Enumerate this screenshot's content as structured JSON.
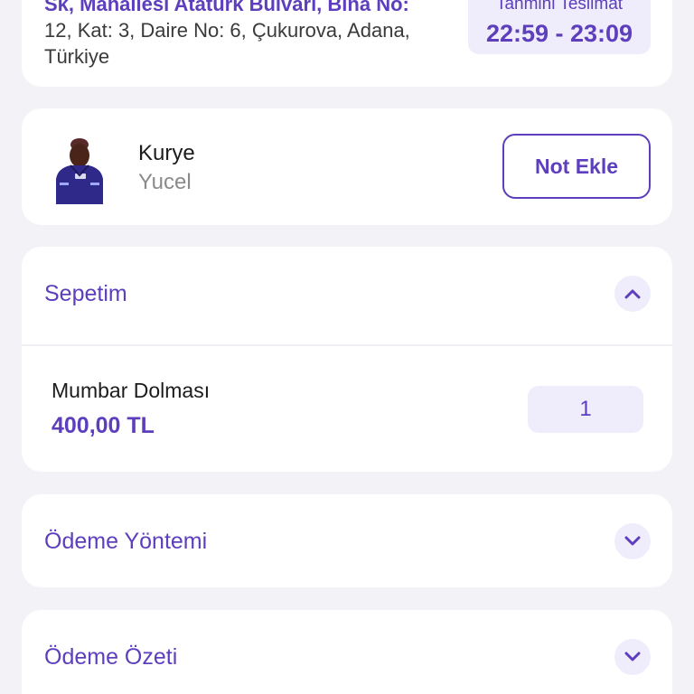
{
  "address": {
    "line_partial": "Sk, Mahallesi Atatürk Bulvarı, Bina No:",
    "line2": "12, Kat: 3, Daire No: 6, Çukurova, Adana,",
    "line3": "Türkiye"
  },
  "eta": {
    "label": "Tahmini Teslimat",
    "value": "22:59 - 23:09"
  },
  "courier": {
    "title": "Kurye",
    "name": "Yucel",
    "note_button": "Not Ekle",
    "avatar_icon": "courier-photo"
  },
  "basket": {
    "title": "Sepetim",
    "toggle_icon": "chevron-up-icon",
    "items": [
      {
        "name": "Mumbar Dolması",
        "price": "400,00 TL",
        "quantity": "1"
      }
    ]
  },
  "payment_method": {
    "title": "Ödeme Yöntemi",
    "toggle_icon": "chevron-down-icon"
  },
  "payment_summary": {
    "title": "Ödeme Özeti",
    "toggle_icon": "chevron-down-icon"
  },
  "colors": {
    "accent": "#5d3ebc",
    "accent_light": "#efedfb",
    "background": "#f3f2f7"
  }
}
